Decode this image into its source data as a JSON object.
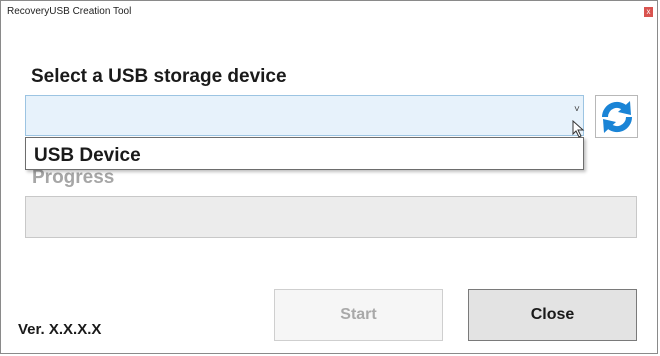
{
  "window": {
    "title": "RecoveryUSB Creation Tool",
    "close_glyph": "x"
  },
  "device_section": {
    "heading": "Select a USB storage device",
    "selected_value": "",
    "dropdown_arrow": "˅",
    "dropdown_options": [
      "USB Device"
    ],
    "refresh_icon": "refresh-icon"
  },
  "progress": {
    "label": "Progress",
    "value": 0
  },
  "buttons": {
    "start": "Start",
    "close": "Close"
  },
  "footer": {
    "version": "Ver. X.X.X.X"
  },
  "colors": {
    "combo_background": "#e7f2fb",
    "refresh_blue": "#1a84d6",
    "disabled_text": "#a6a6a6"
  }
}
